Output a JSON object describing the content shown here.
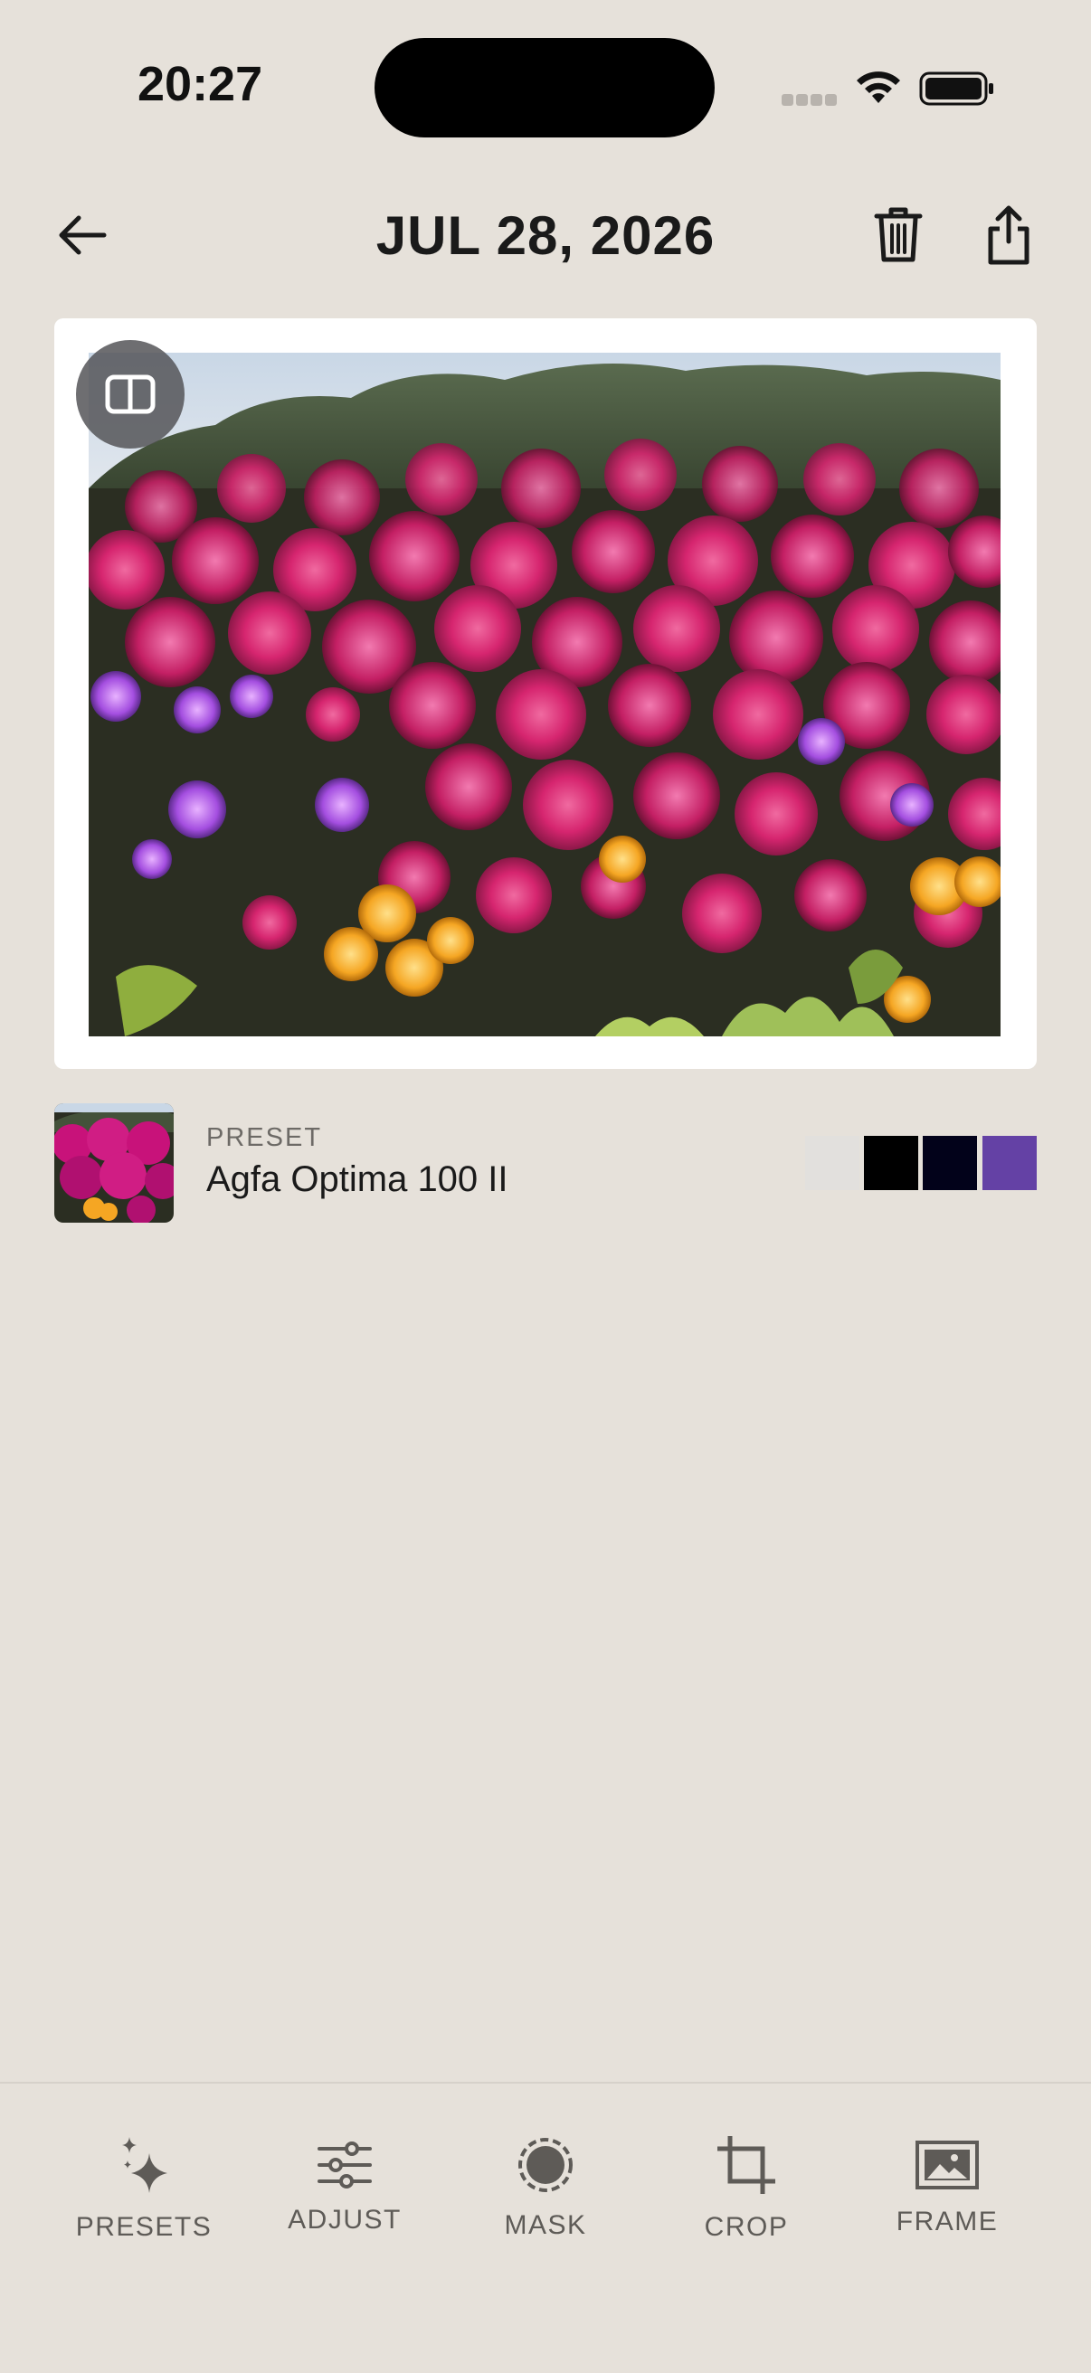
{
  "status_bar": {
    "time": "20:27"
  },
  "header": {
    "title": "JUL 28, 2026",
    "back_icon": "arrow-left-icon",
    "trash_icon": "trash-icon",
    "share_icon": "share-icon"
  },
  "photo": {
    "compare_icon": "split-view-icon"
  },
  "preset": {
    "caption": "PRESET",
    "name": "Agfa Optima 100 II",
    "swatches": [
      "#e2e0dd",
      "#000000",
      "#02021a",
      "#6441a5"
    ]
  },
  "toolbar": {
    "items": [
      {
        "label": "PRESETS",
        "icon": "sparkle-icon"
      },
      {
        "label": "ADJUST",
        "icon": "sliders-icon"
      },
      {
        "label": "MASK",
        "icon": "mask-icon"
      },
      {
        "label": "CROP",
        "icon": "crop-icon"
      },
      {
        "label": "FRAME",
        "icon": "frame-icon"
      }
    ]
  },
  "colors": {
    "background": "#e6e1da",
    "card": "#ffffff",
    "text": "#1a1a1a",
    "muted": "#6d6a66"
  }
}
